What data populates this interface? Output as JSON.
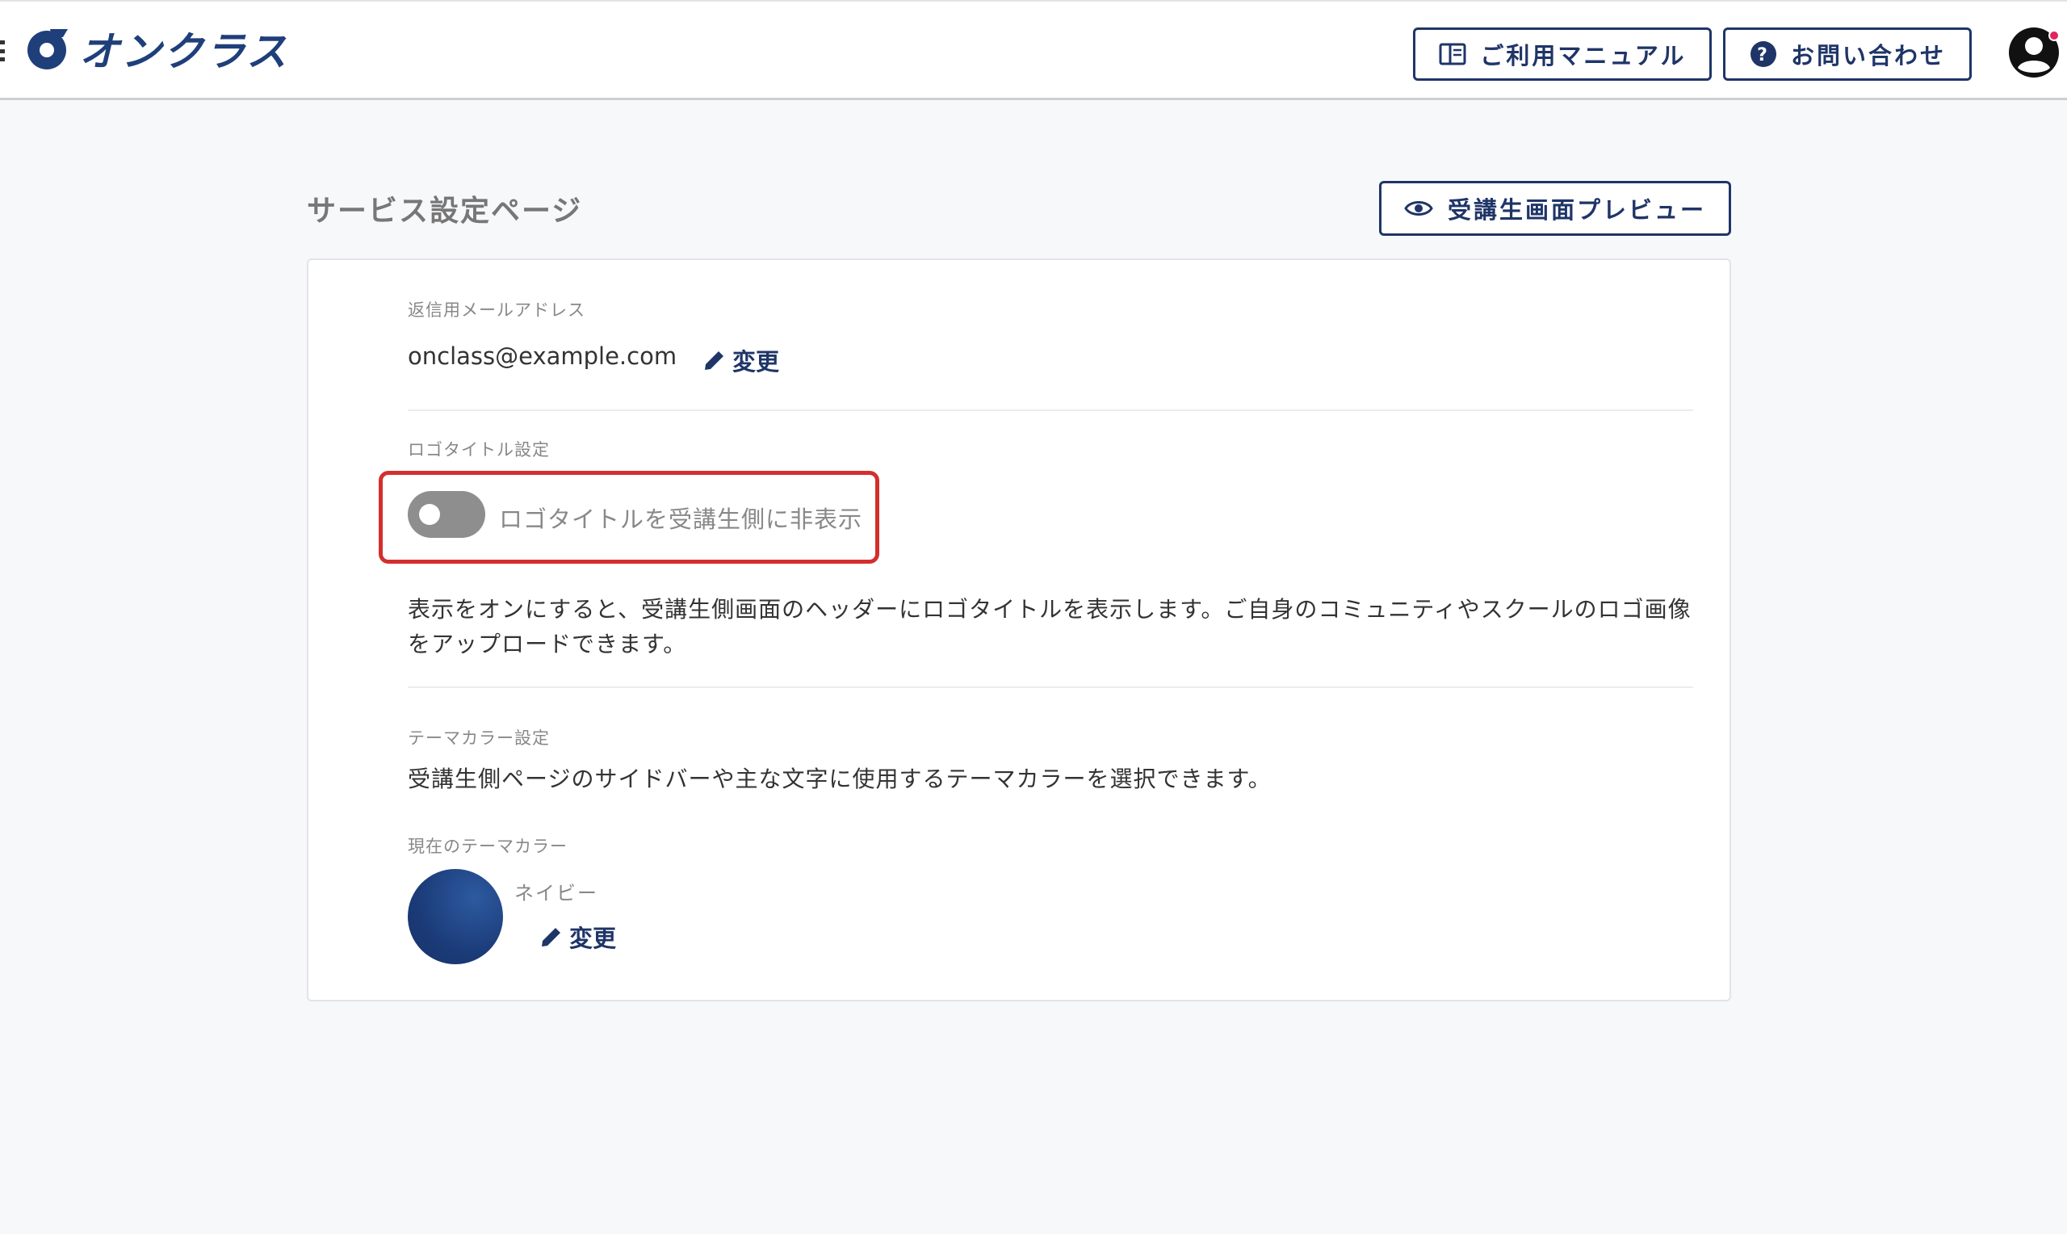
{
  "header": {
    "logo_text": "オンクラス",
    "manual_button": "ご利用マニュアル",
    "contact_button": "お問い合わせ"
  },
  "page": {
    "title": "サービス設定ページ",
    "preview_button": "受講生画面プレビュー"
  },
  "reply_email": {
    "label": "返信用メールアドレス",
    "value": "onclass@example.com",
    "change_label": "変更"
  },
  "logo_title": {
    "label": "ロゴタイトル設定",
    "toggle_label": "ロゴタイトルを受講生側に非表示",
    "toggle_on": false,
    "description_line1": "表示をオンにすると、受講生側画面のヘッダーにロゴタイトルを表示します。ご自身のコミュニティやスクールのロゴ画像",
    "description_line2": "をアップロードできます。"
  },
  "theme_color": {
    "label": "テーマカラー設定",
    "description": "受講生側ページのサイドバーや主な文字に使用するテーマカラーを選択できます。",
    "current_label": "現在のテーマカラー",
    "current_name": "ネイビー",
    "current_hex": "#1f3f7a",
    "change_label": "変更"
  },
  "colors": {
    "brand_navy": "#1f3568",
    "highlight_red": "#d32f2f",
    "notification_pink": "#e0245e"
  }
}
